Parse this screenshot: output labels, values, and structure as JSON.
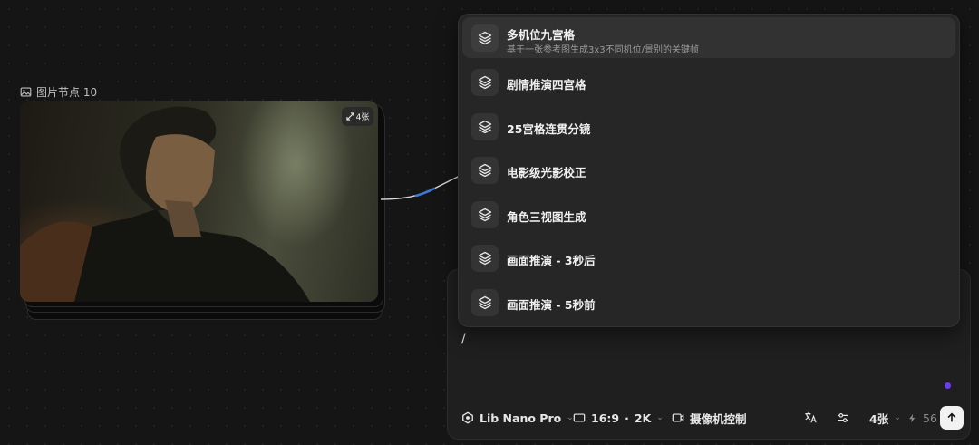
{
  "node": {
    "title": "图片节点 10",
    "count_badge": "4张"
  },
  "menu": {
    "items": [
      {
        "title": "多机位九宫格",
        "subtitle": "基于一张参考图生成3x3不同机位/景别的关键帧"
      },
      {
        "title": "剧情推演四宫格"
      },
      {
        "title": "25宫格连贯分镜"
      },
      {
        "title": "电影级光影校正"
      },
      {
        "title": "角色三视图生成"
      },
      {
        "title": "画面推演 - 3秒后"
      },
      {
        "title": "画面推演 - 5秒前"
      }
    ]
  },
  "prompt": {
    "value": "/"
  },
  "toolbar": {
    "model": "Lib Nano Pro",
    "ratio": "16:9",
    "resolution": "2K",
    "camera": "摄像机控制",
    "count": "4张",
    "credits": "56"
  },
  "colors": {
    "background": "#151515",
    "panel": "#1f1f1f",
    "menu": "#262626",
    "accent_dot": "#6b3cf0",
    "connector": "#3b7bd6"
  }
}
